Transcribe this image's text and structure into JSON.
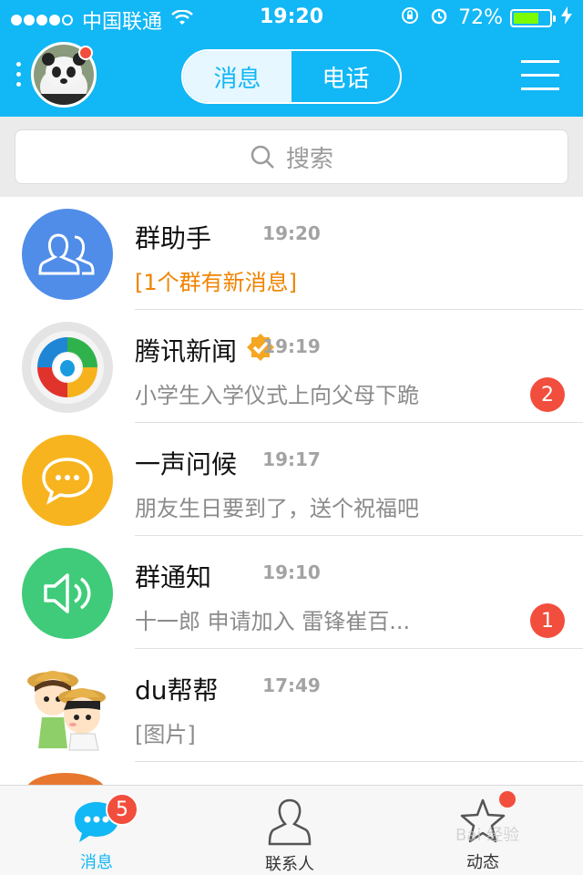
{
  "status_bar": {
    "carrier": "中国联通",
    "time": "19:20",
    "battery_percent": "72%",
    "battery_level": 0.72,
    "icons": [
      "signal-dots",
      "wifi-icon",
      "rotation-lock-icon",
      "alarm-icon",
      "battery-icon",
      "charging-bolt-icon"
    ]
  },
  "nav": {
    "tabs": [
      {
        "label": "消息",
        "active": true
      },
      {
        "label": "电话",
        "active": false
      }
    ],
    "avatar_has_notification": true
  },
  "search": {
    "placeholder": "搜索"
  },
  "conversations": [
    {
      "name": "群助手",
      "time": "19:20",
      "preview": "[1个群有新消息]",
      "badge": null,
      "icon": "group-assistant-icon",
      "color": "#4f8de8"
    },
    {
      "name": "腾讯新闻",
      "time": "19:19",
      "preview": "小学生入学仪式上向父母下跪",
      "badge": "2",
      "icon": "tencent-news-icon",
      "verified": true
    },
    {
      "name": "一声问候",
      "time": "19:17",
      "preview": "朋友生日要到了，送个祝福吧",
      "badge": null,
      "icon": "greeting-chat-icon",
      "color": "#f8b41e"
    },
    {
      "name": "群通知",
      "time": "19:10",
      "preview": "十一郎 申请加入 雷锋崔百...",
      "badge": "1",
      "icon": "speaker-icon",
      "color": "#3fcb7a"
    },
    {
      "name": "du帮帮",
      "time": "17:49",
      "preview": "[图片]",
      "badge": null,
      "icon": "cartoon-avatar-icon"
    }
  ],
  "tabbar": {
    "tabs": [
      {
        "label": "消息",
        "active": true,
        "badge": "5"
      },
      {
        "label": "联系人",
        "active": false
      },
      {
        "label": "动态",
        "active": false,
        "dot": true
      }
    ],
    "watermark": "Bai 经验"
  },
  "colors": {
    "brand": "#12b7f5",
    "badge": "#f24e3d",
    "alert_text": "#f08300"
  }
}
